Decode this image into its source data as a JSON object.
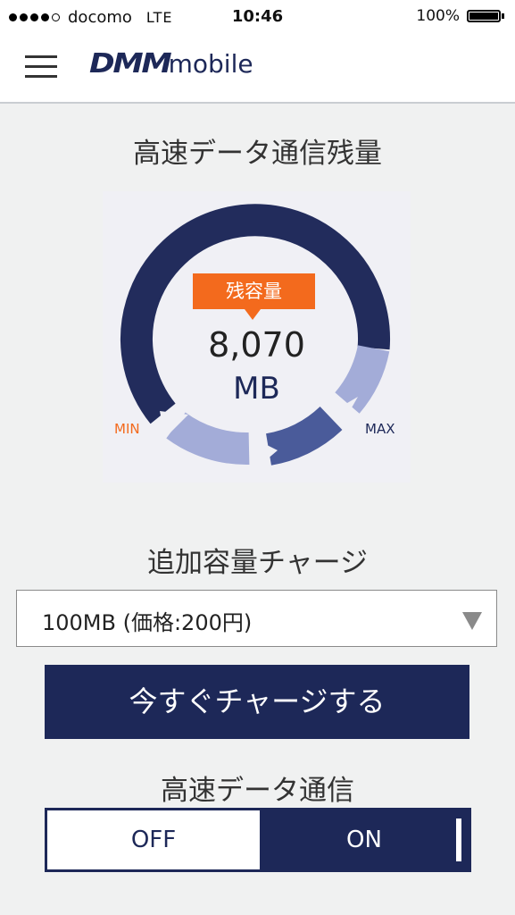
{
  "status_bar": {
    "carrier": "docomo",
    "network": "LTE",
    "time": "10:46",
    "battery": "100%",
    "signal_bars_filled": 4,
    "signal_bars_total": 5
  },
  "header": {
    "logo_main": "DMM",
    "logo_sub": "mobile"
  },
  "gauge": {
    "title": "高速データ通信残量",
    "badge_label": "残容量",
    "remaining_value": "8,070",
    "remaining_unit": "MB",
    "min_label": "MIN",
    "max_label": "MAX"
  },
  "charge": {
    "title": "追加容量チャージ",
    "selected_option": "100MB (価格:200円)",
    "button_label": "今すぐチャージする"
  },
  "speed": {
    "title": "高速データ通信",
    "off_label": "OFF",
    "on_label": "ON",
    "state": "ON"
  },
  "colors": {
    "navy": "#1d2858",
    "orange": "#f36a1d",
    "light_blue": "#a3acd8",
    "mid_blue": "#4a5b9a",
    "background": "#f0f1f1"
  }
}
